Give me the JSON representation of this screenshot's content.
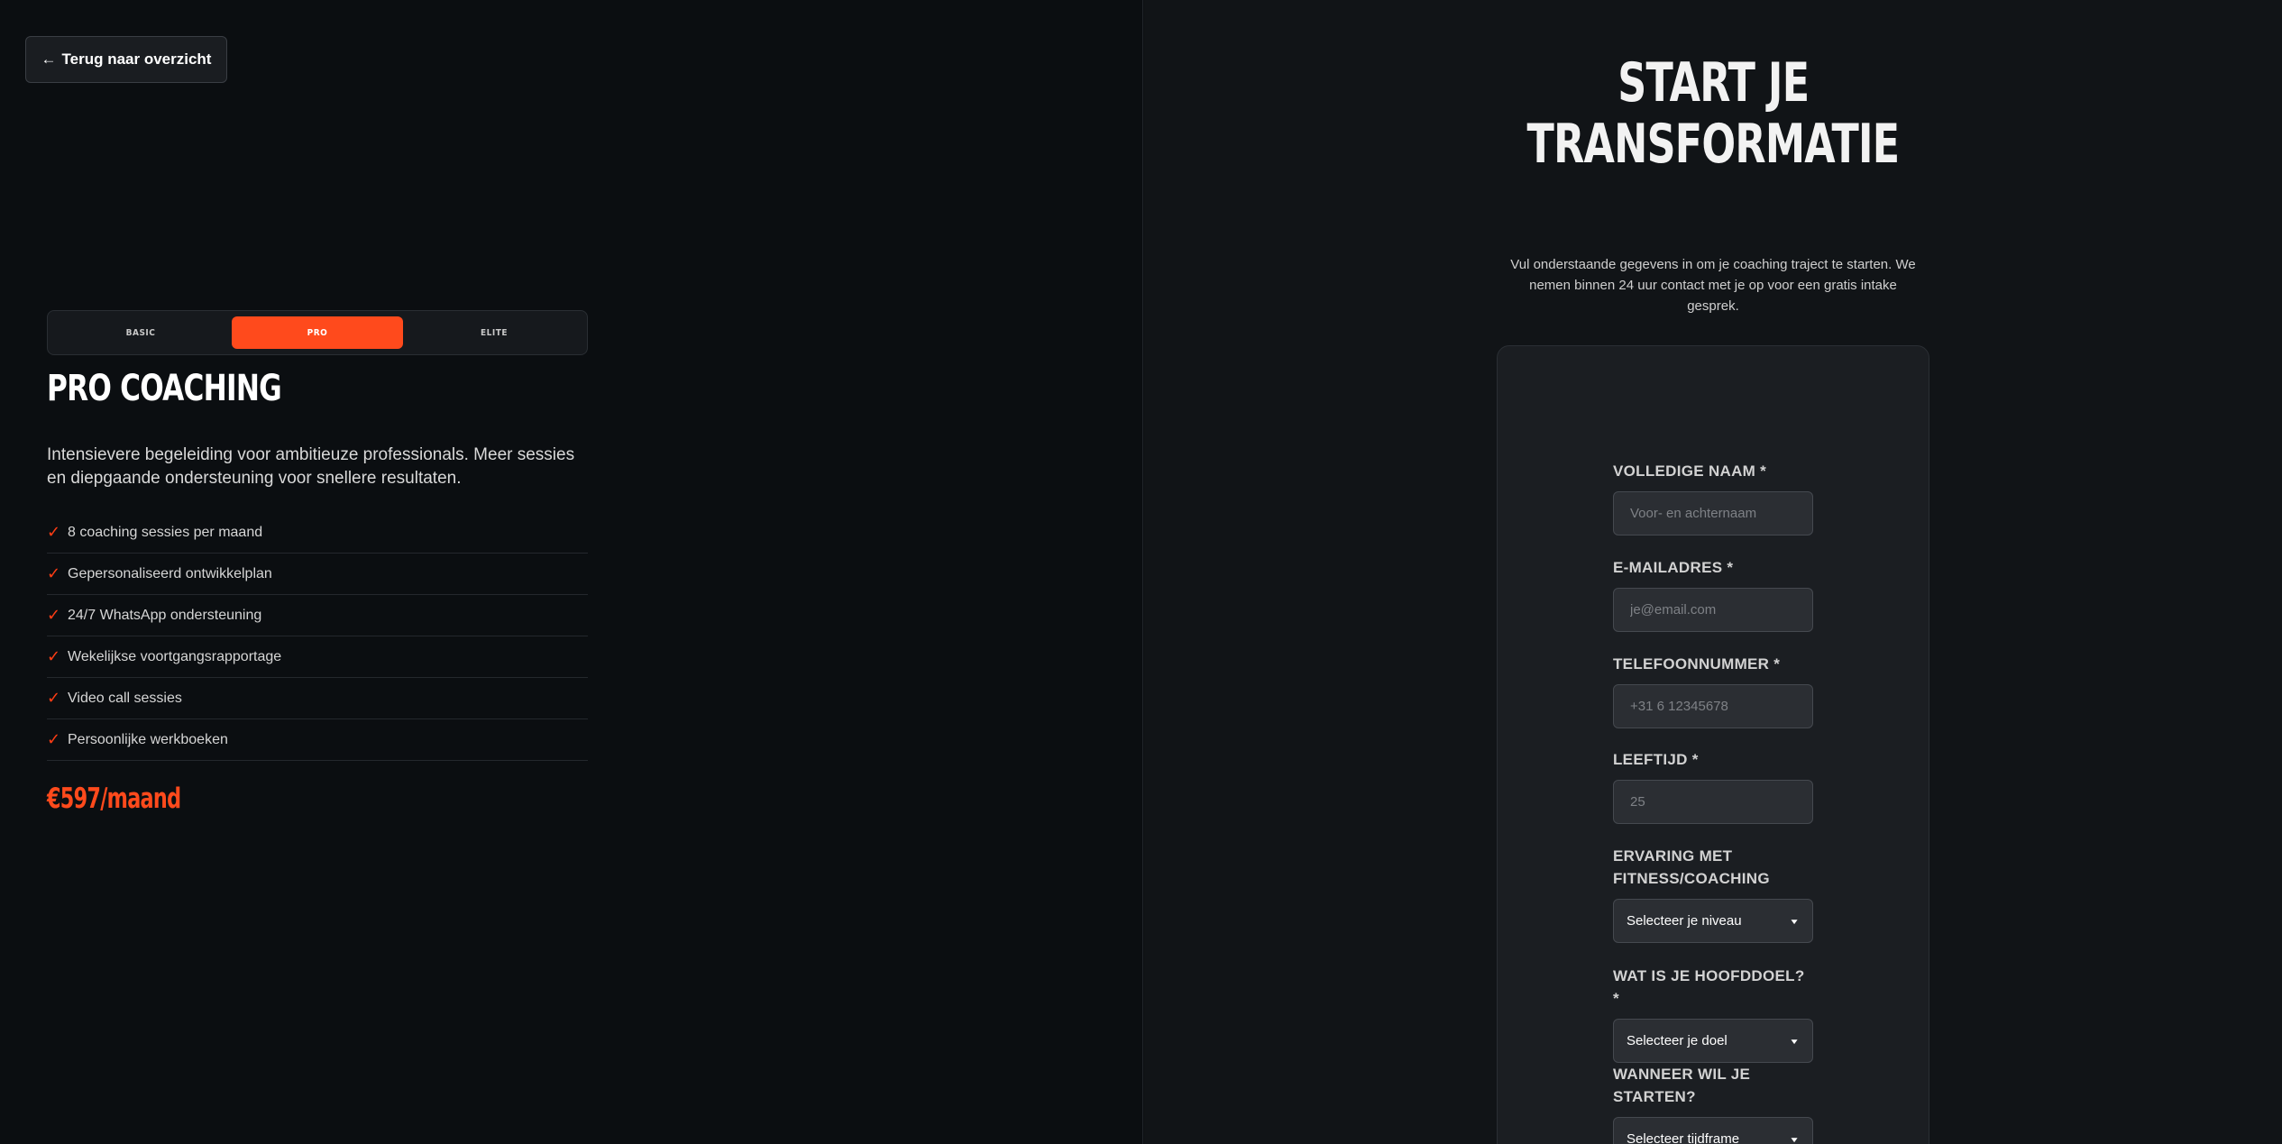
{
  "back_button": {
    "arrow": "←",
    "label": "Terug naar overzicht"
  },
  "tabs": [
    {
      "label": "BASIC",
      "active": false
    },
    {
      "label": "PRO",
      "active": true
    },
    {
      "label": "ELITE",
      "active": false
    }
  ],
  "plan": {
    "title": "PRO COACHING",
    "description": "Intensievere begeleiding voor ambitieuze professionals. Meer sessies en diepgaande ondersteuning voor snellere resultaten.",
    "features": [
      "8 coaching sessies per maand",
      "Gepersonaliseerd ontwikkelplan",
      "24/7 WhatsApp ondersteuning",
      "Wekelijkse voortgangsrapportage",
      "Video call sessies",
      "Persoonlijke werkboeken"
    ],
    "price": "€597/maand"
  },
  "hero": {
    "title_line1": "START JE",
    "title_line2": "TRANSFORMATIE",
    "subtitle": "Vul onderstaande gegevens in om je coaching traject te starten. We nemen binnen 24 uur contact met je op voor een gratis intake gesprek."
  },
  "form": {
    "name": {
      "label": "VOLLEDIGE NAAM *",
      "placeholder": "Voor- en achternaam",
      "value": ""
    },
    "email": {
      "label": "E-MAILADRES *",
      "placeholder": "je@email.com",
      "value": ""
    },
    "phone": {
      "label": "TELEFOONNUMMER *",
      "placeholder": "+31 6 12345678",
      "value": ""
    },
    "age": {
      "label": "LEEFTIJD *",
      "placeholder": "25",
      "value": ""
    },
    "experience": {
      "label": "ERVARING MET FITNESS/COACHING",
      "selected": "Selecteer je niveau"
    },
    "goal": {
      "label": "WAT IS JE HOOFDDOEL? *",
      "selected": "Selecteer je doel"
    },
    "start": {
      "label": "WANNEER WIL JE STARTEN?",
      "selected": "Selecteer tijdframe"
    }
  },
  "colors": {
    "accent": "#ff4a1c",
    "background_left": "#0b0e11",
    "background_right": "#111417",
    "card": "#1b1e22"
  },
  "icons": {
    "back": "arrow-left-icon",
    "check": "checkmark-icon",
    "select": "chevron-down-icon"
  }
}
